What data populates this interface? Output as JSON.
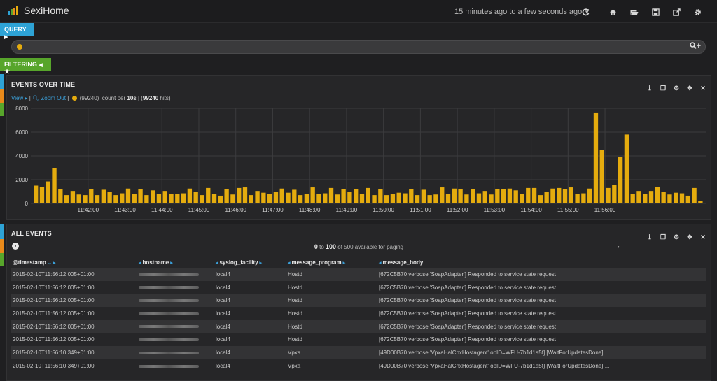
{
  "app": {
    "title": "SexiHome"
  },
  "header": {
    "timerange": "15 minutes ago to a few seconds ago",
    "icons": [
      "refresh-icon",
      "home-icon",
      "folder-open-icon",
      "save-icon",
      "share-icon",
      "gear-icon"
    ]
  },
  "query_strip": {
    "label": "QUERY"
  },
  "query": {
    "value": "",
    "actions": "+"
  },
  "filter_strip": {
    "label": "FILTERING"
  },
  "histogram": {
    "title": "EVENTS OVER TIME",
    "view_label": "View",
    "zoom_out_label": "Zoom Out",
    "series_count": "(99240)",
    "count_per_prefix": "count per",
    "interval": "10s",
    "hits_total": "99240",
    "hits_suffix": "hits)"
  },
  "chart_data": {
    "type": "bar",
    "x_ticks": [
      "11:42:00",
      "11:43:00",
      "11:44:00",
      "11:45:00",
      "11:46:00",
      "11:47:00",
      "11:48:00",
      "11:49:00",
      "11:50:00",
      "11:51:00",
      "11:52:00",
      "11:53:00",
      "11:54:00",
      "11:55:00",
      "11:56:00"
    ],
    "y_ticks": [
      0,
      2000,
      4000,
      6000,
      8000
    ],
    "ylim": [
      0,
      8000
    ],
    "bar_color": "#e5ac0e",
    "grid": true,
    "values": [
      1500,
      1400,
      1850,
      3000,
      1200,
      700,
      1050,
      750,
      700,
      1200,
      700,
      1150,
      1000,
      700,
      850,
      1250,
      800,
      1200,
      700,
      1100,
      800,
      1050,
      800,
      800,
      850,
      1250,
      1000,
      700,
      1300,
      800,
      650,
      1200,
      750,
      1300,
      1350,
      700,
      1050,
      900,
      800,
      1000,
      1250,
      900,
      1150,
      700,
      800,
      1350,
      800,
      850,
      1300,
      750,
      1200,
      1000,
      1200,
      800,
      1300,
      700,
      1200,
      700,
      800,
      900,
      850,
      1200,
      700,
      1150,
      700,
      750,
      1350,
      800,
      1250,
      1200,
      750,
      1200,
      850,
      1050,
      750,
      1200,
      1200,
      1250,
      1100,
      800,
      1300,
      1300,
      700,
      950,
      1250,
      1300,
      1200,
      1350,
      800,
      850,
      1250,
      7650,
      4500,
      1300,
      1550,
      3900,
      5800,
      800,
      1050,
      800,
      1050,
      1400,
      1000,
      750,
      900,
      850,
      650,
      1300,
      200
    ]
  },
  "events": {
    "title": "ALL EVENTS",
    "paging": {
      "from": "0",
      "to_word": "to",
      "to": "100",
      "suffix": "of 500 available for paging"
    },
    "columns": [
      "@timestamp",
      "hostname",
      "syslog_facility",
      "message_program",
      "message_body"
    ],
    "rows": [
      [
        "2015-02-10T11:56:12.005+01:00",
        "local4",
        "Hostd",
        "[672C5B70 verbose 'SoapAdapter'] Responded to service state request"
      ],
      [
        "2015-02-10T11:56:12.005+01:00",
        "local4",
        "Hostd",
        "[672C5B70 verbose 'SoapAdapter'] Responded to service state request"
      ],
      [
        "2015-02-10T11:56:12.005+01:00",
        "local4",
        "Hostd",
        "[672C5B70 verbose 'SoapAdapter'] Responded to service state request"
      ],
      [
        "2015-02-10T11:56:12.005+01:00",
        "local4",
        "Hostd",
        "[672C5B70 verbose 'SoapAdapter'] Responded to service state request"
      ],
      [
        "2015-02-10T11:56:12.005+01:00",
        "local4",
        "Hostd",
        "[672C5B70 verbose 'SoapAdapter'] Responded to service state request"
      ],
      [
        "2015-02-10T11:56:12.005+01:00",
        "local4",
        "Hostd",
        "[672C5B70 verbose 'SoapAdapter'] Responded to service state request"
      ],
      [
        "2015-02-10T11:56:10.349+01:00",
        "local4",
        "Vpxa",
        "[49D00B70 verbose 'VpxaHalCnxHostagent' opID=WFU-7b1d1a5f] [WaitForUpdatesDone] ..."
      ],
      [
        "2015-02-10T11:56:10.349+01:00",
        "local4",
        "Vpxa",
        "[49D00B70 verbose 'VpxaHalCnxHostagent' opID=WFU-7b1d1a5f] [WaitForUpdatesDone] ..."
      ]
    ]
  },
  "colors": {
    "accent_blue": "#2ea3d6",
    "accent_green": "#57a52b",
    "accent_orange": "#e98a1a",
    "bar": "#e5ac0e"
  }
}
